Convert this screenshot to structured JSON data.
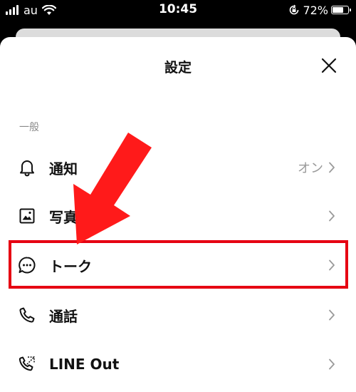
{
  "status_bar": {
    "carrier": "au",
    "time": "10:45",
    "battery_percent": "72%",
    "battery_level": 0.72
  },
  "sheet": {
    "title": "設定",
    "close_icon": "close-icon"
  },
  "section": {
    "label": "一般"
  },
  "items": [
    {
      "label": "通知",
      "value": "オン",
      "icon": "bell-icon"
    },
    {
      "label": "写真",
      "value": "",
      "icon": "photo-icon"
    },
    {
      "label": "トーク",
      "value": "",
      "icon": "chat-bubble-icon"
    },
    {
      "label": "通話",
      "value": "",
      "icon": "phone-icon"
    },
    {
      "label": "LINE Out",
      "value": "",
      "icon": "line-out-icon"
    }
  ],
  "colors": {
    "highlight": "#e60012",
    "arrow": "#ff1a1a",
    "sheet_bg": "#ffffff",
    "secondary_text": "#9a9a9a"
  }
}
